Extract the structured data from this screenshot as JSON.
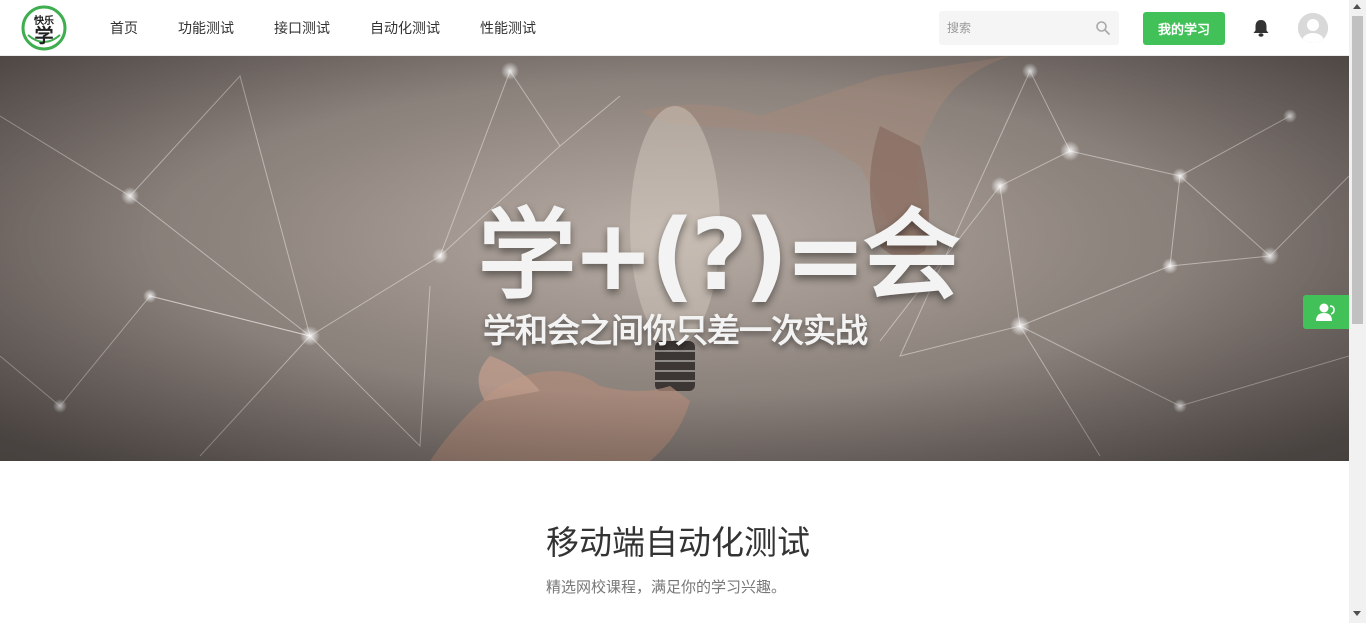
{
  "header": {
    "logo_text": "快乐学",
    "nav": [
      {
        "label": "首页"
      },
      {
        "label": "功能测试"
      },
      {
        "label": "接口测试"
      },
      {
        "label": "自动化测试"
      },
      {
        "label": "性能测试"
      }
    ],
    "search": {
      "placeholder": "搜索"
    },
    "my_study_label": "我的学习"
  },
  "banner": {
    "title": "学+(?)=会",
    "subtitle": "学和会之间你只差一次实战"
  },
  "section": {
    "title": "移动端自动化测试",
    "subtitle": "精选网校课程，满足你的学习兴趣。"
  },
  "colors": {
    "accent": "#43c159",
    "text": "#333333",
    "muted": "#777777"
  },
  "icons": {
    "search": "search-icon",
    "bell": "bell-icon",
    "avatar": "user-avatar-icon",
    "side": "contact-user-icon"
  }
}
